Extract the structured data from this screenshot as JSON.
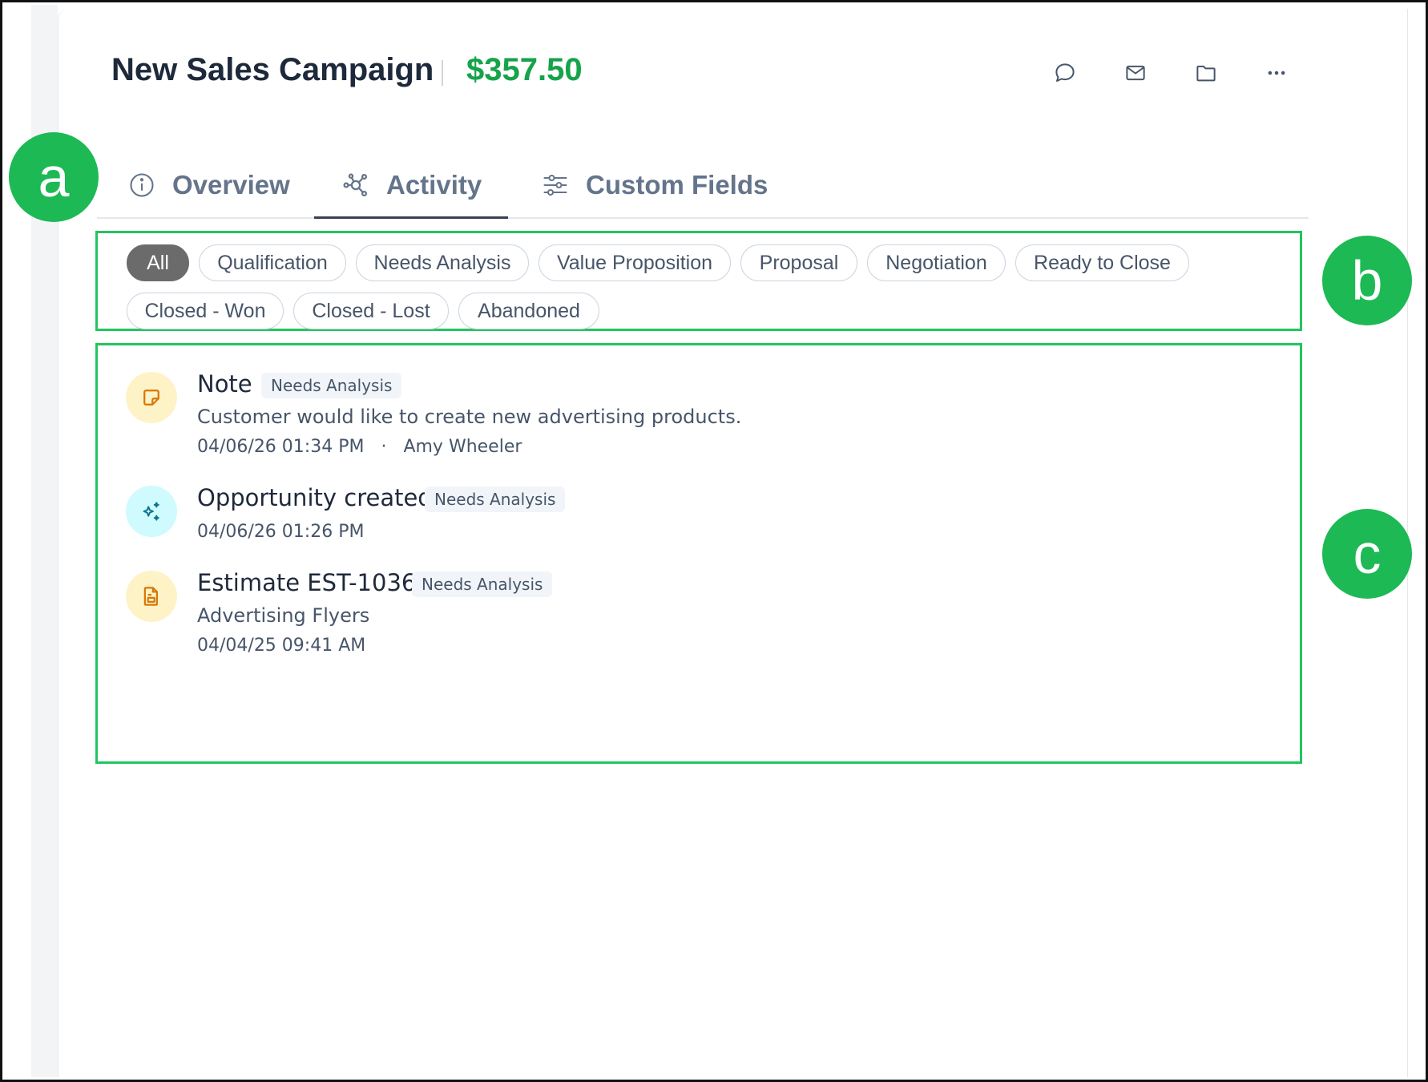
{
  "header": {
    "title": "New Sales Campaign",
    "amount": "$357.50",
    "icons": [
      "chat-bubble-icon",
      "mail-icon",
      "folder-icon",
      "more-icon"
    ]
  },
  "tabs": [
    {
      "label": "Overview",
      "icon": "info-icon",
      "active": false
    },
    {
      "label": "Activity",
      "icon": "activity-graph-icon",
      "active": true
    },
    {
      "label": "Custom Fields",
      "icon": "sliders-icon",
      "active": false
    }
  ],
  "filters": {
    "active": "All",
    "chips": [
      "All",
      "Qualification",
      "Needs Analysis",
      "Value Proposition",
      "Proposal",
      "Negotiation",
      "Ready to Close",
      "Closed - Won",
      "Closed - Lost",
      "Abandoned"
    ]
  },
  "activities": [
    {
      "icon": "sticky-note-icon",
      "title": "Note",
      "stage": "Needs Analysis",
      "description": "Customer would like to create new advertising products.",
      "timestamp": "04/06/26 01:34 PM",
      "separator": "·",
      "author": "Amy Wheeler"
    },
    {
      "icon": "sparkles-icon",
      "title": "Opportunity created",
      "stage": "Needs Analysis",
      "timestamp": "04/06/26 01:26 PM"
    },
    {
      "icon": "document-icon",
      "title": "Estimate EST-1036",
      "stage": "Needs Analysis",
      "description": "Advertising Flyers",
      "timestamp": "04/04/25 09:41 AM"
    }
  ],
  "annotations": {
    "a": "a",
    "b": "b",
    "c": "c"
  },
  "colors": {
    "accent_green": "#16a34a",
    "annotation_green": "#1db954",
    "active_chip": "#6b6b6b",
    "note_icon_bg": "#fef3c7",
    "sparkle_icon_bg": "#cffafe"
  }
}
